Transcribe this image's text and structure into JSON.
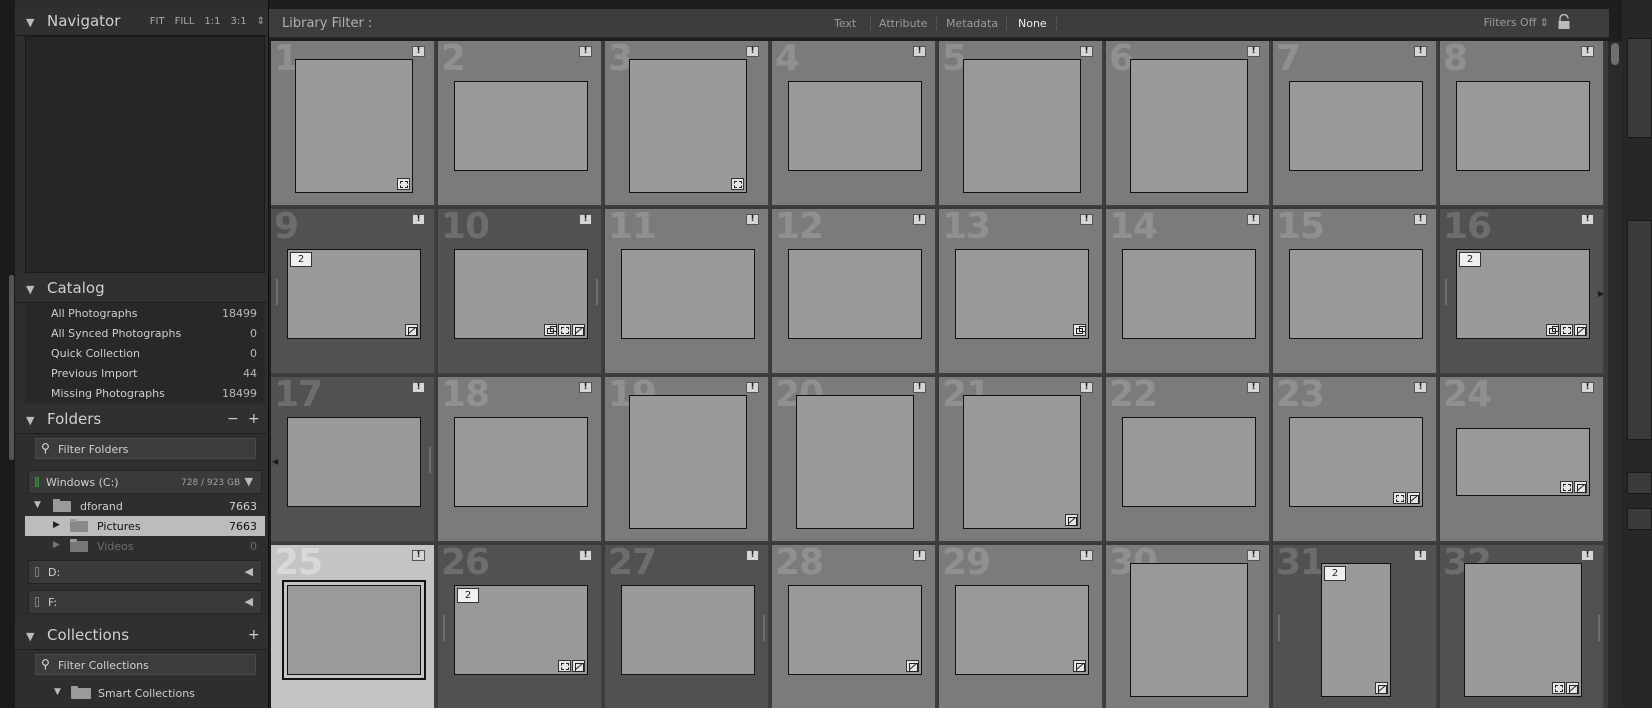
{
  "navigator": {
    "title": "Navigator",
    "options": [
      "FIT",
      "FILL",
      "1:1",
      "3:1"
    ],
    "spin": "⇕"
  },
  "catalog": {
    "title": "Catalog",
    "items": [
      {
        "label": "All Photographs",
        "count": "18499"
      },
      {
        "label": "All Synced Photographs",
        "count": "0"
      },
      {
        "label": "Quick Collection",
        "count": "0"
      },
      {
        "label": "Previous Import",
        "count": "44"
      },
      {
        "label": "Missing Photographs",
        "count": "18499"
      }
    ]
  },
  "folders": {
    "title": "Folders",
    "minus": "−",
    "plus": "+",
    "filter_placeholder": "Filter Folders",
    "volume_c": {
      "name": "Windows (C:)",
      "size": "728 / 923 GB"
    },
    "tree": [
      {
        "name": "dforand",
        "count": "7663"
      },
      {
        "name": "Pictures",
        "count": "7663"
      },
      {
        "name": "Videos",
        "count": "0"
      }
    ],
    "volume_d": {
      "name": "D:"
    },
    "volume_f": {
      "name": "F:"
    }
  },
  "collections": {
    "title": "Collections",
    "plus": "+",
    "filter_placeholder": "Filter Collections",
    "smart": "Smart Collections"
  },
  "library_filter": {
    "label": "Library Filter :",
    "options": [
      "Text",
      "Attribute",
      "Metadata",
      "None"
    ],
    "selected": "None",
    "filters_off": "Filters Off ⇕"
  },
  "grid": {
    "cells": [
      {
        "n": "1",
        "shade": "light",
        "o": "p"
      },
      {
        "n": "2",
        "shade": "light",
        "o": "l"
      },
      {
        "n": "3",
        "shade": "light",
        "o": "p"
      },
      {
        "n": "4",
        "shade": "light",
        "o": "l"
      },
      {
        "n": "5",
        "shade": "light",
        "o": "p"
      },
      {
        "n": "6",
        "shade": "light",
        "o": "p"
      },
      {
        "n": "7",
        "shade": "light",
        "o": "l"
      },
      {
        "n": "8",
        "shade": "light",
        "o": "l"
      },
      {
        "n": "9",
        "shade": "dark",
        "o": "l",
        "stack": "2"
      },
      {
        "n": "10",
        "shade": "dark",
        "o": "l"
      },
      {
        "n": "11",
        "shade": "light",
        "o": "l"
      },
      {
        "n": "12",
        "shade": "light",
        "o": "l"
      },
      {
        "n": "13",
        "shade": "light",
        "o": "l"
      },
      {
        "n": "14",
        "shade": "light",
        "o": "l"
      },
      {
        "n": "15",
        "shade": "light",
        "o": "l"
      },
      {
        "n": "16",
        "shade": "dark",
        "o": "l",
        "stack": "2"
      },
      {
        "n": "17",
        "shade": "dark",
        "o": "l"
      },
      {
        "n": "18",
        "shade": "light",
        "o": "l"
      },
      {
        "n": "19",
        "shade": "light",
        "o": "p"
      },
      {
        "n": "20",
        "shade": "light",
        "o": "p"
      },
      {
        "n": "21",
        "shade": "light",
        "o": "p"
      },
      {
        "n": "22",
        "shade": "light",
        "o": "l"
      },
      {
        "n": "23",
        "shade": "light",
        "o": "l"
      },
      {
        "n": "24",
        "shade": "light",
        "o": "w"
      },
      {
        "n": "25",
        "shade": "selected",
        "o": "l"
      },
      {
        "n": "26",
        "shade": "dark",
        "o": "l",
        "stack": "2"
      },
      {
        "n": "27",
        "shade": "dark",
        "o": "l"
      },
      {
        "n": "28",
        "shade": "light",
        "o": "l"
      },
      {
        "n": "29",
        "shade": "light",
        "o": "l"
      },
      {
        "n": "30",
        "shade": "light",
        "o": "p"
      },
      {
        "n": "31",
        "shade": "dark",
        "o": "p2",
        "stack": "2"
      },
      {
        "n": "32",
        "shade": "dark",
        "o": "p"
      }
    ]
  }
}
